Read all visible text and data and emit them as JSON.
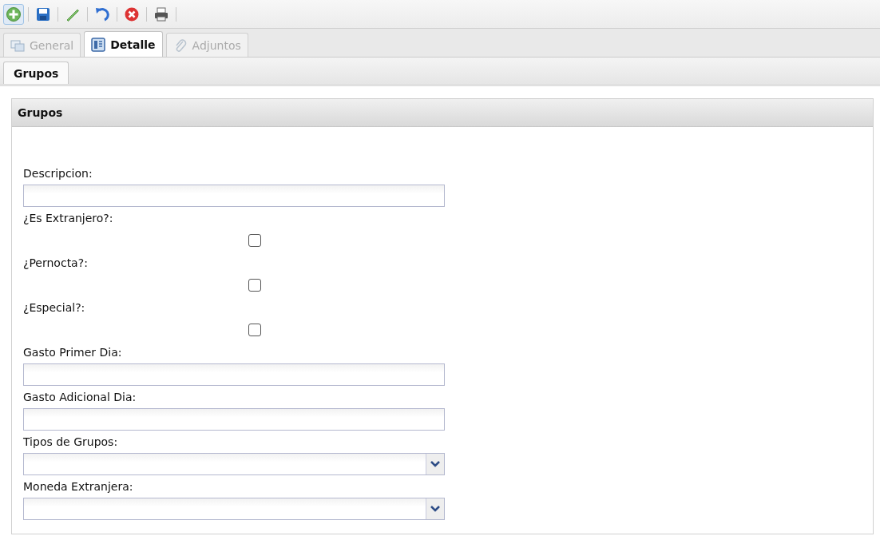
{
  "toolbar": [
    {
      "kind": "add",
      "selected": true
    },
    {
      "kind": "save",
      "selected": false
    },
    {
      "kind": "edit",
      "selected": false
    },
    {
      "kind": "undo",
      "selected": false
    },
    {
      "kind": "delete",
      "selected": false
    },
    {
      "kind": "print",
      "selected": false
    }
  ],
  "tabs": [
    {
      "label": "General",
      "kind": "general",
      "selected": false,
      "disabled": true
    },
    {
      "label": "Detalle",
      "kind": "detail",
      "selected": true,
      "disabled": false
    },
    {
      "label": "Adjuntos",
      "kind": "attach",
      "selected": false,
      "disabled": true
    }
  ],
  "subtabs": [
    {
      "label": "Grupos",
      "selected": true
    }
  ],
  "panel": {
    "title": "Grupos",
    "fields": [
      {
        "label": "Descripcion:",
        "kind": "text"
      },
      {
        "label": "¿Es Extranjero?:",
        "kind": "checkbox",
        "checked": false
      },
      {
        "label": "¿Pernocta?:",
        "kind": "checkbox",
        "checked": false
      },
      {
        "label": "¿Especial?:",
        "kind": "checkbox",
        "checked": false
      },
      {
        "label": "Gasto Primer Dia:",
        "kind": "text"
      },
      {
        "label": "Gasto Adicional Dia:",
        "kind": "text"
      },
      {
        "label": "Tipos de Grupos:",
        "kind": "select"
      },
      {
        "label": "Moneda Extranjera:",
        "kind": "select"
      }
    ]
  }
}
